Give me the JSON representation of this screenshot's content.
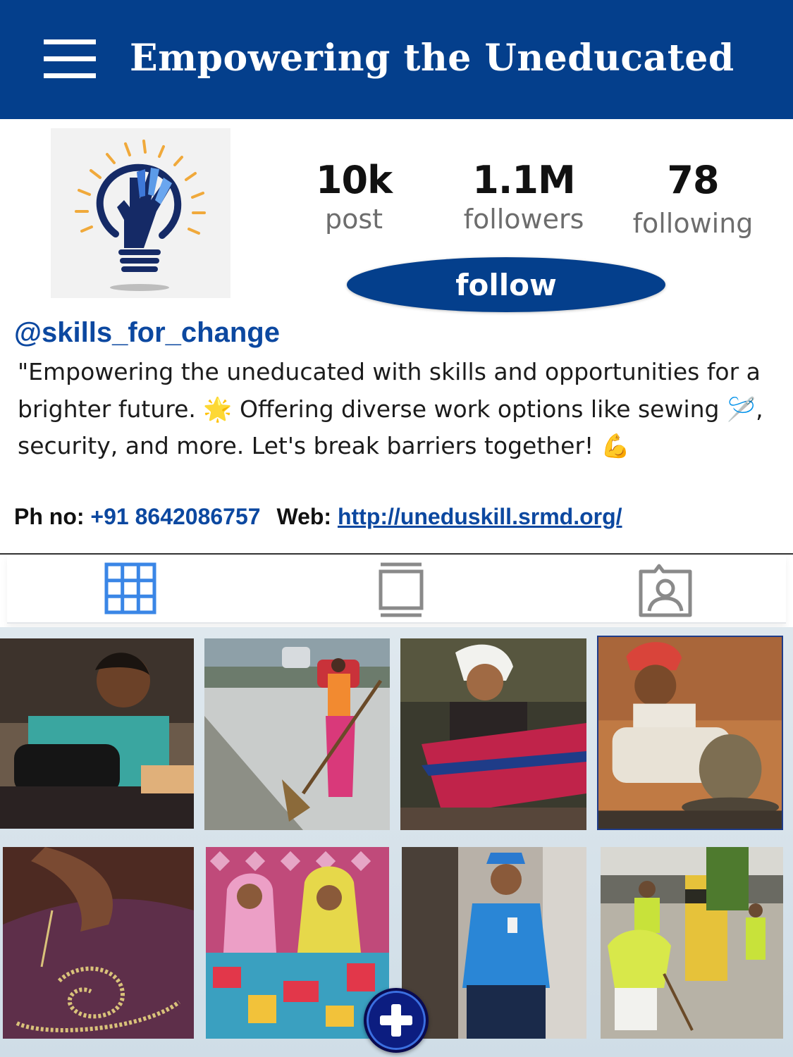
{
  "header": {
    "title": "Empowering the Uneducated",
    "menu_icon": "hamburger-menu-icon"
  },
  "profile": {
    "avatar_icon": "lightbulb-hand-logo",
    "stats": {
      "posts_value": "10k",
      "posts_label": "post",
      "followers_value": "1.1M",
      "followers_label": "followers",
      "following_value": "78",
      "following_label": "following"
    },
    "follow_label": "follow",
    "username": "@skills_for_change",
    "bio_part1": "\"Empowering the uneducated with skills and opportunities for a brighter future. ",
    "bio_emoji1": "🌟",
    "bio_part2": " Offering diverse work options like sewing ",
    "bio_emoji2": "🪡",
    "bio_part3": ", security, and more. Let's break barriers together! ",
    "bio_emoji3": "💪",
    "phone_label": "Ph no:",
    "phone_value": "+91 8642086757",
    "web_label": "Web:",
    "web_value": "http://uneduskill.srmd.org/"
  },
  "tabs": [
    {
      "icon": "grid-icon",
      "active": true
    },
    {
      "icon": "reels-icon",
      "active": false
    },
    {
      "icon": "tagged-person-icon",
      "active": false
    }
  ],
  "gallery": [
    {
      "subject": "woman-sewing-machine"
    },
    {
      "subject": "woman-sweeping-road"
    },
    {
      "subject": "woman-weaving-loom"
    },
    {
      "subject": "man-pottery-wheel"
    },
    {
      "subject": "hand-embroidery-closeup"
    },
    {
      "subject": "women-patchwork-craft"
    },
    {
      "subject": "security-guard"
    },
    {
      "subject": "street-cleaning-workers"
    }
  ],
  "add_button_icon": "plus-icon",
  "colors": {
    "brand_blue": "#043f8c",
    "link_blue": "#0c48a0",
    "tab_active": "#3a86e6",
    "tab_inactive": "#8a8a8a",
    "add_button": "#0c1d80"
  }
}
